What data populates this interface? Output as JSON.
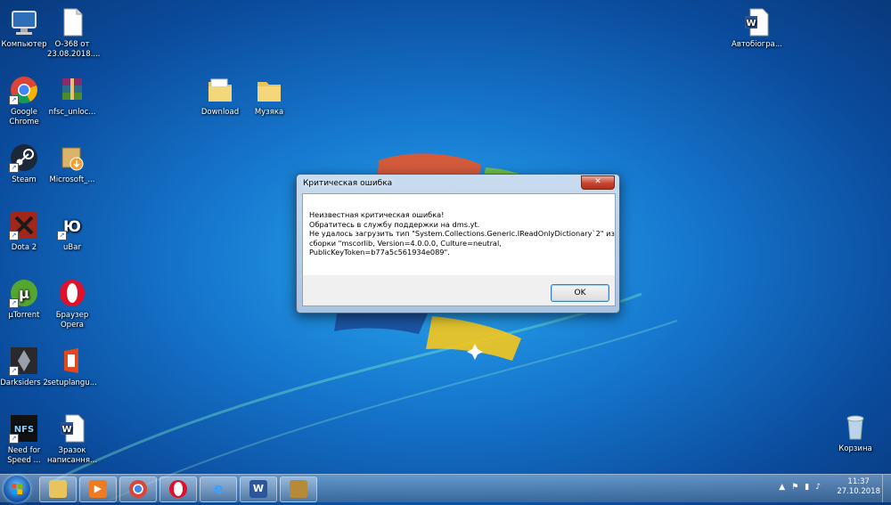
{
  "desktop": {
    "icons": [
      {
        "label": "Компьютер",
        "icon": "computer-icon"
      },
      {
        "label": "О-368 от 23.08.2018....",
        "icon": "document-icon"
      },
      {
        "label": "Google Chrome",
        "icon": "chrome-icon"
      },
      {
        "label": "nfsc_unloc...",
        "icon": "winrar-icon"
      },
      {
        "label": "Download",
        "icon": "folder-icon"
      },
      {
        "label": "Музяка",
        "icon": "folder-icon"
      },
      {
        "label": "Steam",
        "icon": "steam-icon"
      },
      {
        "label": "Microsoft_...",
        "icon": "installer-icon"
      },
      {
        "label": "Dota 2",
        "icon": "dota-icon"
      },
      {
        "label": "uBar",
        "icon": "ubar-icon"
      },
      {
        "label": "µTorrent",
        "icon": "utorrent-icon"
      },
      {
        "label": "Браузер Opera",
        "icon": "opera-icon"
      },
      {
        "label": "Darksiders 2",
        "icon": "darksiders-icon"
      },
      {
        "label": "setuplangu...",
        "icon": "office-icon"
      },
      {
        "label": "Need for Speed ...",
        "icon": "nfs-icon"
      },
      {
        "label": "Зразок написання...",
        "icon": "word-doc-icon"
      },
      {
        "label": "Автобіогра...",
        "icon": "word-doc-icon"
      },
      {
        "label": "Корзина",
        "icon": "recycle-bin-icon"
      }
    ]
  },
  "dialog": {
    "title": "Критическая ошибка",
    "close_label": "✕",
    "lines": [
      "Неизвестная критическая ошибка!",
      "Обратитесь в службу поддержки на dms.yt.",
      "Не удалось загрузить тип \"System.Collections.Generic.IReadOnlyDictionary`2\" из",
      "сборки \"mscorlib, Version=4.0.0.0, Culture=neutral,",
      "PublicKeyToken=b77a5c561934e089\"."
    ],
    "ok_label": "OK"
  },
  "taskbar": {
    "pinned": [
      "explorer-icon",
      "media-player-icon",
      "chrome-icon",
      "opera-icon",
      "internet-explorer-icon",
      "word-icon",
      "game-icon"
    ],
    "clock_time": "11:37",
    "clock_date": "27.10.2018",
    "tray_chevron": "▲"
  },
  "colors": {
    "desktop_bg": "#1679cf",
    "dialog_frame": "#a9c4e0",
    "close_button": "#c7452e"
  }
}
